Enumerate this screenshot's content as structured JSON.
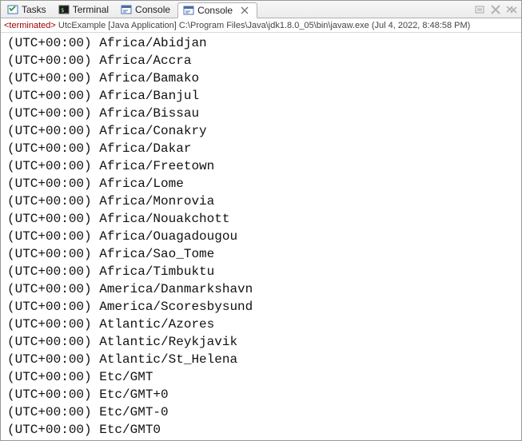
{
  "tabs": [
    {
      "label": "Tasks",
      "icon": "tasks-icon"
    },
    {
      "label": "Terminal",
      "icon": "terminal-icon"
    },
    {
      "label": "Console",
      "icon": "console-icon"
    },
    {
      "label": "Console",
      "icon": "console-icon",
      "active": true
    }
  ],
  "toolbar": {
    "minimize": "–",
    "maximize": "□"
  },
  "status": {
    "tag": "<terminated>",
    "app": "UtcExample [Java Application]",
    "path": "C:\\Program Files\\Java\\jdk1.8.0_05\\bin\\javaw.exe",
    "time": "(Jul 4, 2022, 8:48:58 PM)"
  },
  "output": [
    {
      "offset": "(UTC+00:00)",
      "zone": "Africa/Abidjan"
    },
    {
      "offset": "(UTC+00:00)",
      "zone": "Africa/Accra"
    },
    {
      "offset": "(UTC+00:00)",
      "zone": "Africa/Bamako"
    },
    {
      "offset": "(UTC+00:00)",
      "zone": "Africa/Banjul"
    },
    {
      "offset": "(UTC+00:00)",
      "zone": "Africa/Bissau"
    },
    {
      "offset": "(UTC+00:00)",
      "zone": "Africa/Conakry"
    },
    {
      "offset": "(UTC+00:00)",
      "zone": "Africa/Dakar"
    },
    {
      "offset": "(UTC+00:00)",
      "zone": "Africa/Freetown"
    },
    {
      "offset": "(UTC+00:00)",
      "zone": "Africa/Lome"
    },
    {
      "offset": "(UTC+00:00)",
      "zone": "Africa/Monrovia"
    },
    {
      "offset": "(UTC+00:00)",
      "zone": "Africa/Nouakchott"
    },
    {
      "offset": "(UTC+00:00)",
      "zone": "Africa/Ouagadougou"
    },
    {
      "offset": "(UTC+00:00)",
      "zone": "Africa/Sao_Tome"
    },
    {
      "offset": "(UTC+00:00)",
      "zone": "Africa/Timbuktu"
    },
    {
      "offset": "(UTC+00:00)",
      "zone": "America/Danmarkshavn"
    },
    {
      "offset": "(UTC+00:00)",
      "zone": "America/Scoresbysund"
    },
    {
      "offset": "(UTC+00:00)",
      "zone": "Atlantic/Azores"
    },
    {
      "offset": "(UTC+00:00)",
      "zone": "Atlantic/Reykjavik"
    },
    {
      "offset": "(UTC+00:00)",
      "zone": "Atlantic/St_Helena"
    },
    {
      "offset": "(UTC+00:00)",
      "zone": "Etc/GMT"
    },
    {
      "offset": "(UTC+00:00)",
      "zone": "Etc/GMT+0"
    },
    {
      "offset": "(UTC+00:00)",
      "zone": "Etc/GMT-0"
    },
    {
      "offset": "(UTC+00:00)",
      "zone": "Etc/GMT0"
    }
  ]
}
